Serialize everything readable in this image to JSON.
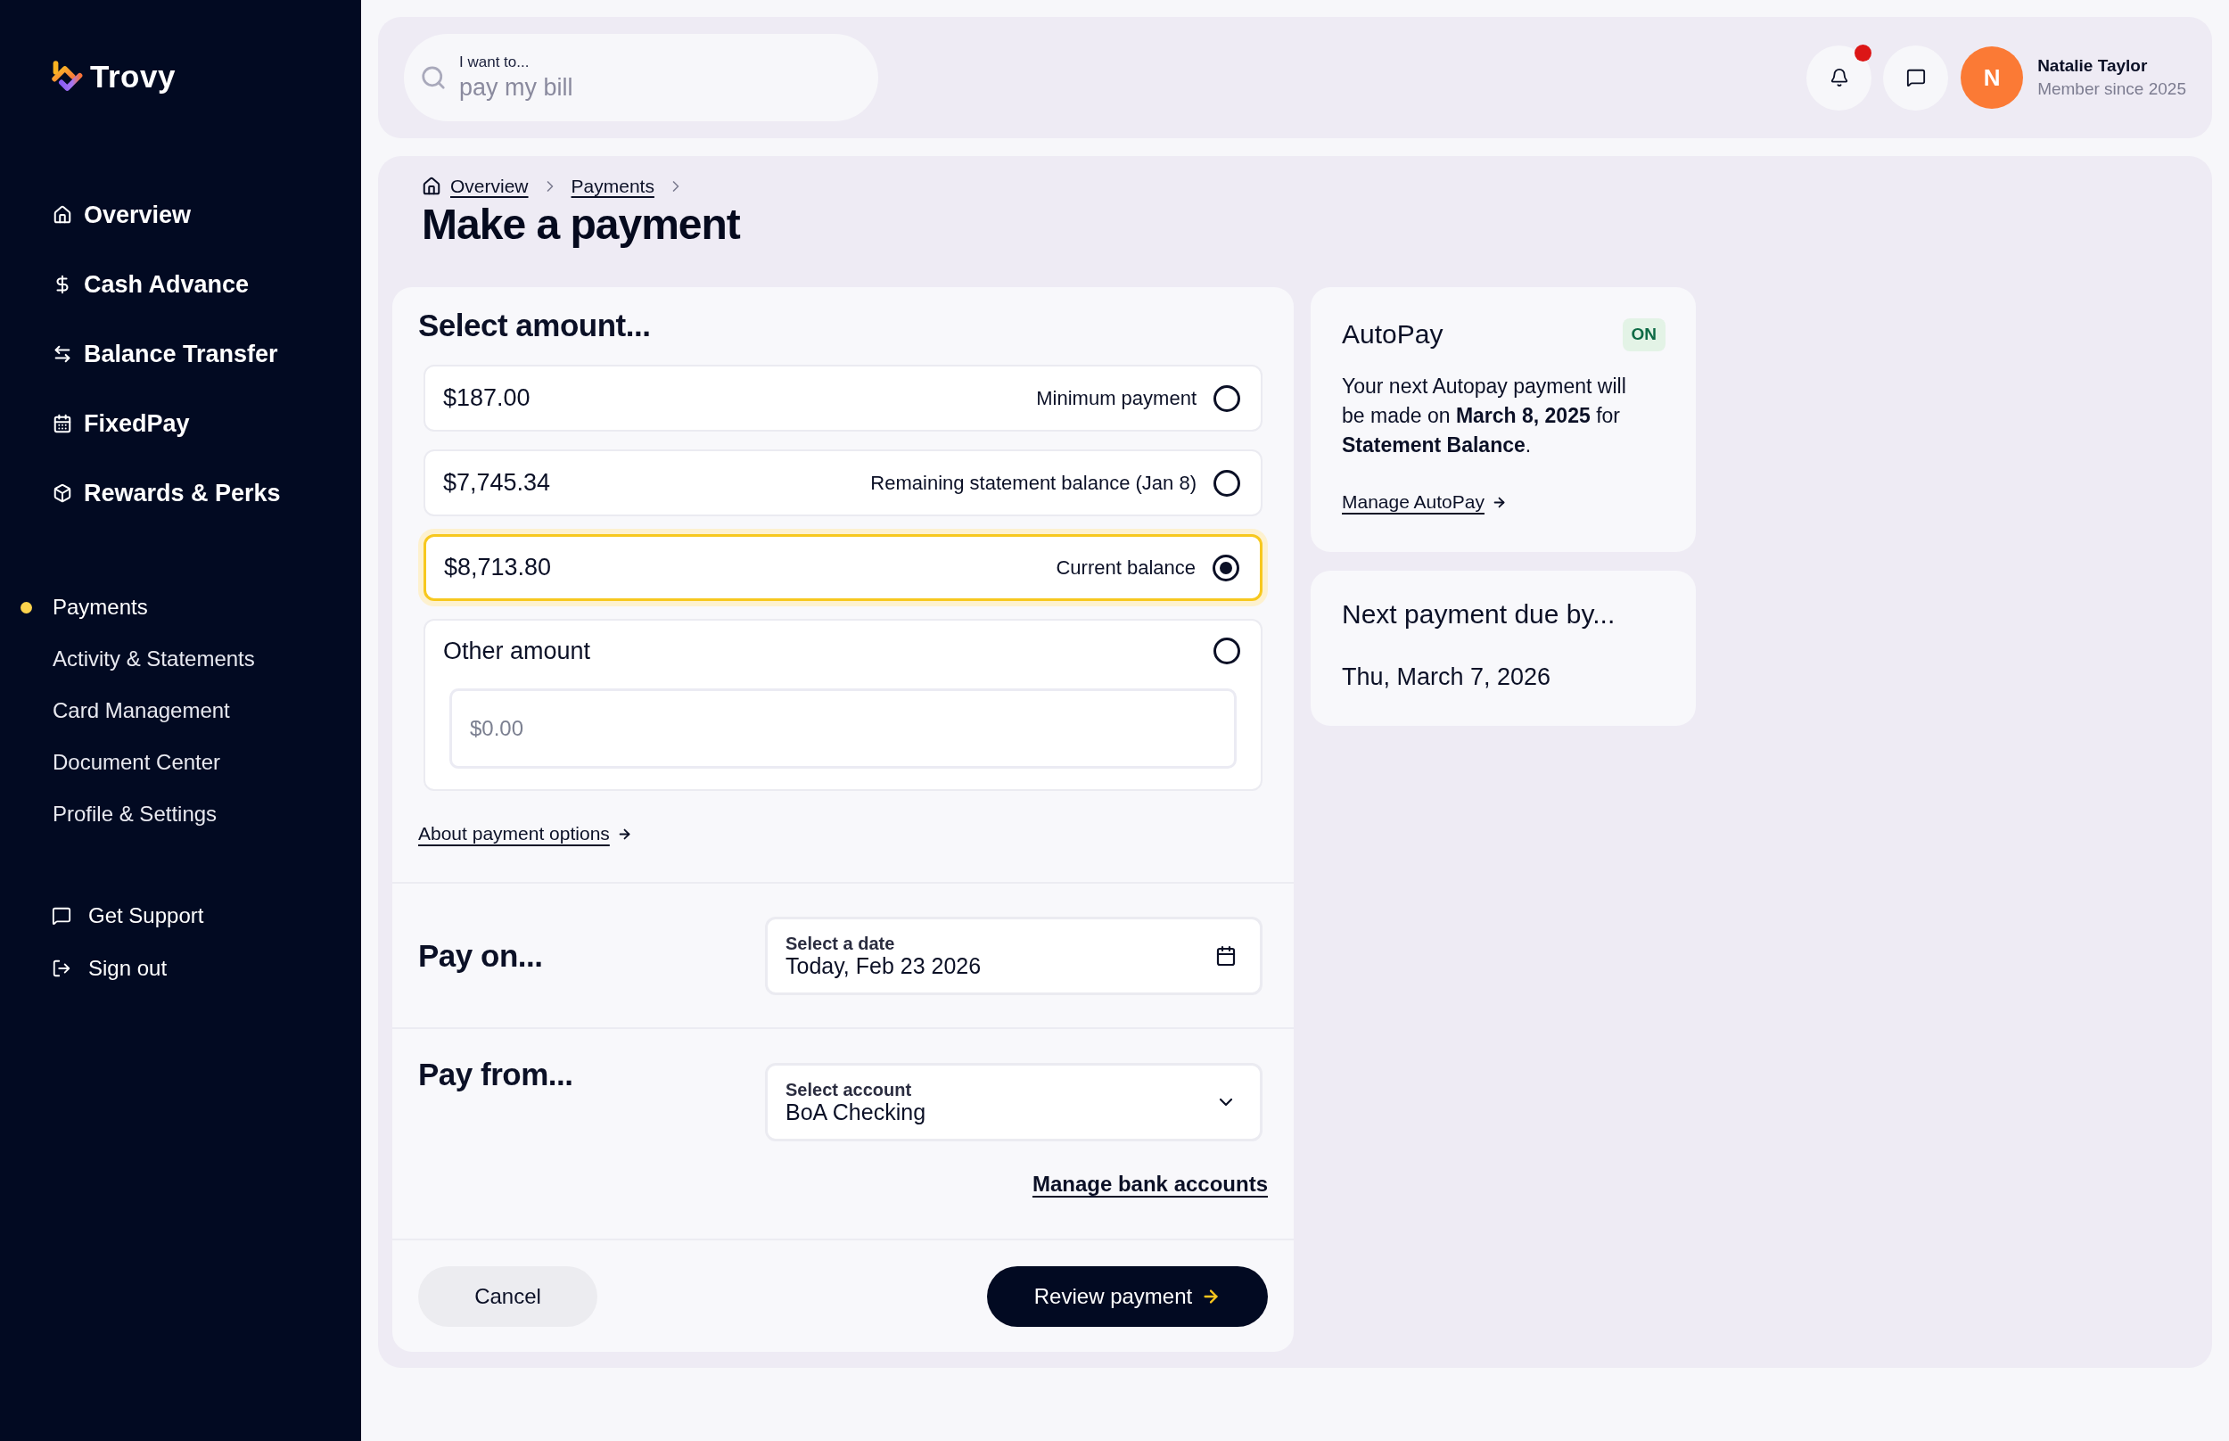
{
  "sidebar": {
    "brand": "Trovy",
    "primary_nav": [
      {
        "label": "Overview"
      },
      {
        "label": "Cash Advance"
      },
      {
        "label": "Balance Transfer"
      },
      {
        "label": "FixedPay"
      },
      {
        "label": "Rewards & Perks"
      }
    ],
    "secondary_nav": [
      {
        "label": "Payments",
        "selected": true
      },
      {
        "label": "Activity & Statements",
        "selected": false
      },
      {
        "label": "Card Management",
        "selected": false
      },
      {
        "label": "Document Center",
        "selected": false
      },
      {
        "label": "Profile & Settings",
        "selected": false
      }
    ],
    "support_nav": [
      {
        "label": "Get Support"
      },
      {
        "label": "Sign out"
      }
    ]
  },
  "header": {
    "search": {
      "label": "I want to...",
      "placeholder": "pay my bill"
    },
    "notifications": {
      "unread": true
    },
    "user": {
      "initial": "N",
      "name": "Natalie Taylor",
      "subtitle": "Member since 2025"
    }
  },
  "breadcrumb": [
    {
      "label": "Overview"
    },
    {
      "label": "Payments"
    }
  ],
  "title": "Make a payment",
  "amount_section": {
    "heading": "Select amount...",
    "options": [
      {
        "kind": "preset",
        "amount": "$187.00",
        "label": "Minimum payment",
        "selected": false
      },
      {
        "kind": "preset",
        "amount": "$7,745.34",
        "label": "Remaining statement balance (Jan 8)",
        "selected": false
      },
      {
        "kind": "preset",
        "amount": "$8,713.80",
        "label": "Current balance",
        "selected": true
      },
      {
        "kind": "custom",
        "label": "Other amount",
        "placeholder": "$0.00",
        "selected": false
      }
    ],
    "link": "About payment options"
  },
  "pay_on": {
    "heading": "Pay on...",
    "field_label": "Select a date",
    "value": "Today, Feb 23 2026"
  },
  "pay_from": {
    "heading": "Pay from...",
    "field_label": "Select account",
    "value": "BoA Checking",
    "link": "Manage bank accounts"
  },
  "actions": {
    "cancel": "Cancel",
    "submit": "Review payment"
  },
  "autopay": {
    "title": "AutoPay",
    "status": "ON",
    "on": true,
    "description": "Your next Autopay payment will be made on **March 8, 2025** for **Statement Balance**.",
    "link": "Manage AutoPay"
  },
  "next_payment": {
    "title": "Next payment due by...",
    "date": "Thu, March 7, 2026"
  }
}
